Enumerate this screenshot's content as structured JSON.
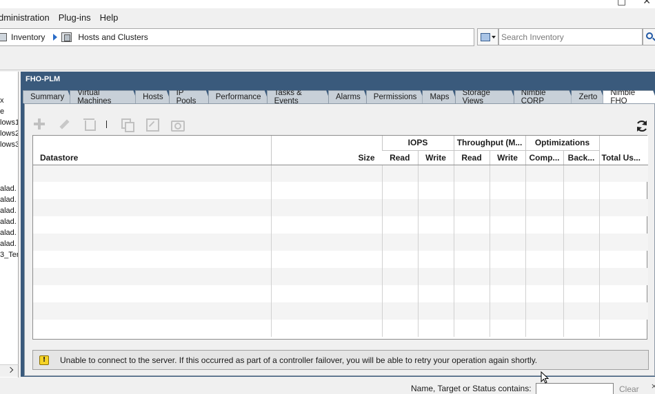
{
  "window": {
    "controls": [
      "□",
      "✕"
    ]
  },
  "menu": {
    "items": [
      "dministration",
      "Plug-ins",
      "Help"
    ]
  },
  "breadcrumb": {
    "items": [
      "Inventory",
      "Hosts and Clusters"
    ]
  },
  "search": {
    "placeholder": "Search Inventory"
  },
  "tree": {
    "items": [
      "x",
      "e",
      "lows1",
      "lows2",
      "lows3",
      "alad.",
      "alad.",
      "alad.",
      "alad.",
      "alad.",
      "alad.",
      "3_Ter"
    ]
  },
  "panel": {
    "title": "FHO-PLM",
    "tabs": [
      "Summary",
      "Virtual Machines",
      "Hosts",
      "IP Pools",
      "Performance",
      "Tasks & Events",
      "Alarms",
      "Permissions",
      "Maps",
      "Storage Views",
      "Nimble CORP",
      "Zerto",
      "Nimble FHO"
    ],
    "active_tab": "Nimble FHO"
  },
  "table": {
    "group_headers": {
      "iops": "IOPS",
      "throughput": "Throughput (M...",
      "optimizations": "Optimizations"
    },
    "columns": {
      "datastore": "Datastore",
      "size": "Size",
      "iops_read": "Read",
      "iops_write": "Write",
      "tp_read": "Read",
      "tp_write": "Write",
      "compression": "Comp...",
      "backup": "Back...",
      "total_usage": "Total Us..."
    },
    "empty_rows": 10
  },
  "status": {
    "severity": "warning",
    "icon_glyph": "!",
    "message": "Unable to connect to the server.  If this occurred as part of a controller failover, you will be able to retry your operation again shortly."
  },
  "filter": {
    "label": "Name, Target or Status contains:",
    "clear_label": "Clear",
    "close_glyph": "×"
  },
  "colors": {
    "panel_header": "#3a5a7c",
    "tab_bg": "#c8d0d8",
    "warning": "#f5d327",
    "accent": "#1f57a4"
  }
}
